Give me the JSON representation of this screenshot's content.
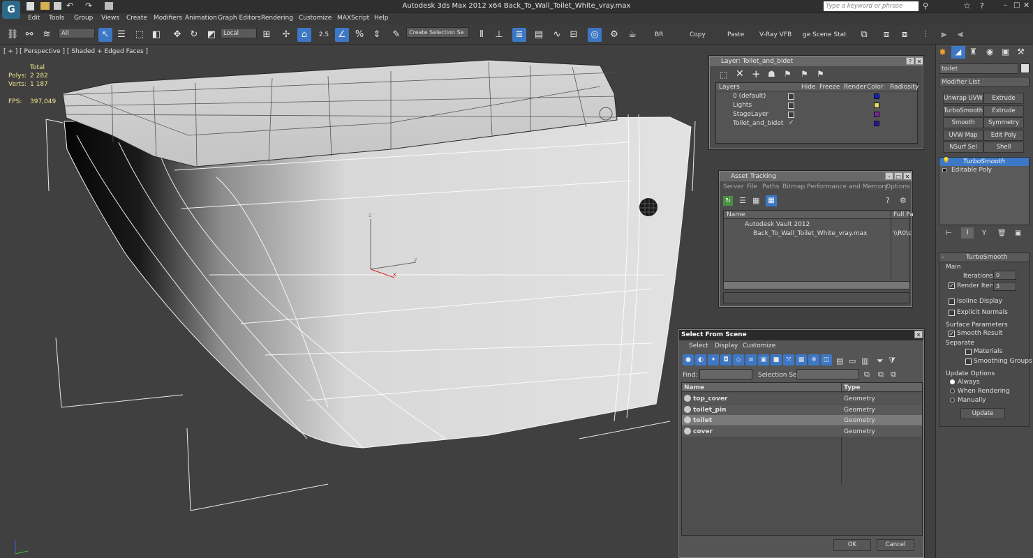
{
  "app": {
    "title": "Autodesk 3ds Max  2012 x64     Back_To_Wall_Toilet_White_vray.max",
    "search_placeholder": "Type a keyword or phrase"
  },
  "menu": [
    "Edit",
    "Tools",
    "Group",
    "Views",
    "Create",
    "Modifiers",
    "Animation",
    "Graph Editors",
    "Rendering",
    "Customize",
    "MAXScript",
    "Help"
  ],
  "toolbar": {
    "filter": "All",
    "ref_coord": "Local",
    "angle_snap": "2.5",
    "sel_set": "Create Selection Se",
    "labels": [
      "BR",
      "Copy",
      "Paste",
      "V-Ray VFB",
      "ge Scene Stat"
    ]
  },
  "viewport": {
    "label": "[ + ] [ Perspective ] [ Shaded + Edged Faces ]",
    "stats_header": "Total",
    "polys_label": "Polys:",
    "polys": "2 282",
    "verts_label": "Verts:",
    "verts": "1 187",
    "fps_label": "FPS:",
    "fps": "397,049",
    "axis_z": "z",
    "axis_y": "y",
    "axis_x": "x"
  },
  "layer_dialog": {
    "title": "Layer: Toilet_and_bidet",
    "columns": [
      "Layers",
      "Hide",
      "Freeze",
      "Render",
      "Color",
      "Radiosity"
    ],
    "rows": [
      {
        "name": "0 (default)",
        "color": "#1020c0"
      },
      {
        "name": "Lights",
        "color": "#e0e060"
      },
      {
        "name": "StageLayer",
        "color": "#8020a0"
      },
      {
        "name": "Toilet_and_bidet",
        "color": "#3010a0"
      }
    ]
  },
  "asset_tracking": {
    "title": "Asset Tracking",
    "menu": [
      "Server",
      "File",
      "Paths",
      "Bitmap Performance and Memory",
      "Options"
    ],
    "col_name": "Name",
    "col_path": "Full Pa",
    "vault": "Autodesk Vault 2012",
    "file": "Back_To_Wall_Toilet_White_vray.max",
    "file_path": "\\\\R0\\c"
  },
  "select_scene": {
    "title": "Select From Scene",
    "menu": [
      "Select",
      "Display",
      "Customize"
    ],
    "find_label": "Find:",
    "selset_label": "Selection Set:",
    "col_name": "Name",
    "col_type": "Type",
    "rows": [
      {
        "name": "top_cover",
        "type": "Geometry"
      },
      {
        "name": "toilet_pin",
        "type": "Geometry"
      },
      {
        "name": "toilet",
        "type": "Geometry"
      },
      {
        "name": "cover",
        "type": "Geometry"
      }
    ],
    "ok": "OK",
    "cancel": "Cancel"
  },
  "command_panel": {
    "object_name": "toilet",
    "modifier_list": "Modifier List",
    "mod_buttons": [
      "Unwrap UVW",
      "Extrude",
      "TurboSmooth",
      "Extrude",
      "Smooth",
      "Symmetry",
      "UVW Map",
      "Edit Poly",
      "NSurf Sel",
      "Shell"
    ],
    "stack": [
      "TurboSmooth",
      "Editable Poly"
    ],
    "rollout": "TurboSmooth",
    "main": "Main",
    "iterations_label": "Iterations:",
    "iterations": "0",
    "render_iters_label": "Render Iters:",
    "render_iters": "3",
    "isoline": "Isoline Display",
    "explicit": "Explicit Normals",
    "surface": "Surface Parameters",
    "smooth_result": "Smooth Result",
    "separate": "Separate",
    "materials": "Materials",
    "smoothing_groups": "Smoothing Groups",
    "update_options": "Update Options",
    "always": "Always",
    "when_rendering": "When Rendering",
    "manually": "Manually",
    "update": "Update"
  }
}
